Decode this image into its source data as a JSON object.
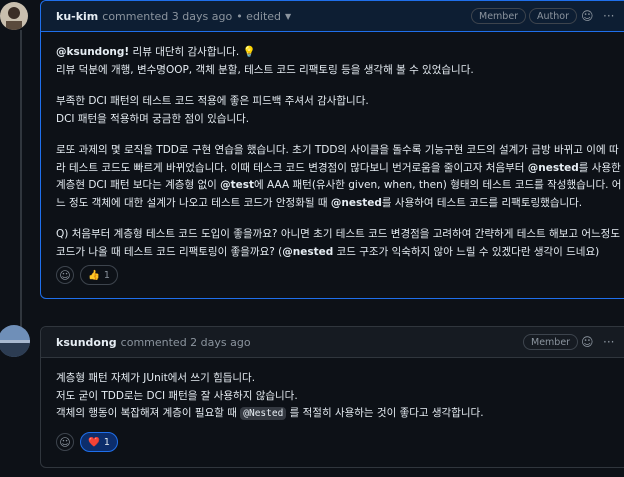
{
  "comments": [
    {
      "author": "ku-kim",
      "meta": "commented 3 days ago",
      "edited": "• edited",
      "badges": [
        "Member",
        "Author"
      ],
      "paragraphs": [
        {
          "mention": "@ksundong!",
          "text": " 리뷰 대단히 감사합니다. 💡",
          "line2": "리뷰 덕분에 개행, 변수명OOP, 객체 분할, 테스트 코드 리팩토링 등을 생각해 볼 수 있었습니다."
        },
        {
          "line1": "부족한 DCI 패턴의 테스트 코드 적용에 좋은 피드백 주셔서 감사합니다.",
          "line2": "DCI 패턴을 적용하며 궁금한 점이 있습니다."
        },
        {
          "l1": "로또 과제의 몇 로직을 TDD로 구현 연습을 했습니다. 초기 TDD의 사이클을 돌수록 기능구현 코드의 설계가 금방 바뀌고 이에 따",
          "l2": "라 테스트 코드도 빠르게 바뀌었습니다. 이때 테스크 코드 변경점이 많다보니 번거로움을 줄이고자 처음부터 ",
          "l2m": "@nested",
          "l2b": "를 사용한",
          "l3": "계층현 DCI 패턴 보다는 계층형 없이 ",
          "l3m": "@test",
          "l3b": "에 AAA 패턴(유사한 given, when, then) 형태의 테스트 코드를 작성했습니다. 어",
          "l4": "느 정도 객체에 대한 설계가 나오고 테스트 코드가 안정화될 때 ",
          "l4m": "@nested",
          "l4b": "를 사용하여 테스트 코드를 리팩토링했습니다."
        },
        {
          "l1": "Q) 처음부터 계층형 테스트 코드 도입이 좋을까요? 아니면 초기 테스트 코드 변경점을 고려하여 간략하게 테스트 해보고 어느정도",
          "l2": "코드가 나올 때 테스트 코드 리팩토링이 좋을까요? (",
          "l2m": "@nested",
          "l2b": " 코드 구조가 익숙하지 않아 느릴 수 있겠다란 생각이 드네요)"
        }
      ],
      "reaction": {
        "emoji": "👍",
        "count": "1"
      }
    },
    {
      "author": "ksundong",
      "meta": "commented 2 days ago",
      "badges": [
        "Member"
      ],
      "lines": [
        "계층형 패턴 자체가 JUnit에서 쓰기 힘듭니다.",
        "저도 굳이 TDD로는 DCI 패턴을 잘 사용하지 않습니다."
      ],
      "line3a": "객체의 행동이 복잡해져 계층이 필요할 때 ",
      "line3code": "@Nested",
      "line3b": " 를 적절히 사용하는 것이 좋다고 생각합니다.",
      "reaction": {
        "emoji": "❤️",
        "count": "1"
      }
    }
  ],
  "icons": {
    "emoji": "☺",
    "more": "···",
    "caret": "▼"
  },
  "colors": {
    "background": "#0d1117",
    "border": "#30363d",
    "accent": "#1f6feb",
    "muted": "#8b949e",
    "text": "#e6edf3"
  }
}
